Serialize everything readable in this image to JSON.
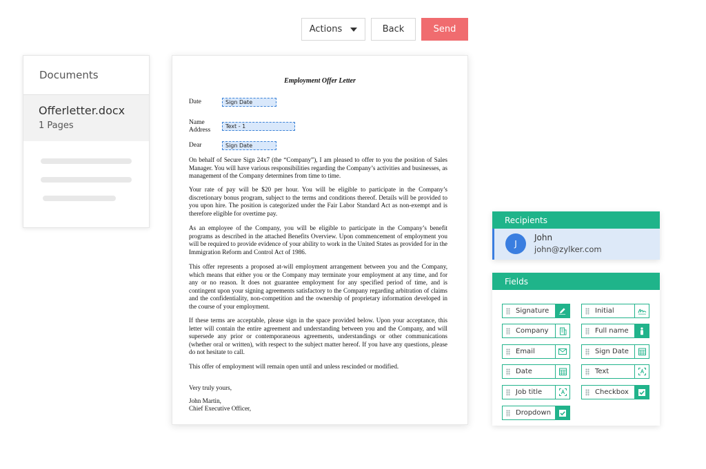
{
  "toolbar": {
    "actions_label": "Actions",
    "back_label": "Back",
    "send_label": "Send"
  },
  "documents": {
    "heading": "Documents",
    "item": {
      "name": "Offerletter.docx",
      "pages": "1 Pages"
    }
  },
  "document": {
    "title": "Employment Offer Letter",
    "labels": {
      "date": "Date",
      "name": "Name",
      "address": "Address",
      "dear": "Dear"
    },
    "fields": {
      "date": "Sign Date",
      "name": "Text - 1",
      "dear": "Sign Date"
    },
    "paragraphs": [
      "On behalf of Secure Sign 24x7 (the “Company”), I am pleased to offer to you the position of Sales Manager. You will have various responsibilities regarding the Company’s activities and businesses, as management of the Company determines from time to time.",
      "Your rate of pay will be $20 per hour. You will be eligible to participate in the Company’s discretionary bonus program, subject to the terms and conditions thereof. Details will be provided to you upon hire. The position is categorized under the Fair Labor Standard Act as non-exempt and is therefore eligible for overtime pay.",
      "As an employee of the Company, you will be eligible to participate in the Company’s benefit programs as described in the attached Benefits Overview. Upon commencement of employment you will be required to provide evidence of your ability to work in the United States as provided for in the Immigration Reform and Control Act of 1986.",
      "This offer represents a proposed at-will employment arrangement between you and the Company, which means that either you or the Company may terminate your employment at any time, and for any or no reason. It does not guarantee employment for any specified period of time, and is contingent upon your signing agreements satisfactory to the Company regarding arbitration of claims and the confidentiality, non-competition and the ownership of proprietary information developed in the course of your employment.",
      "If these terms are acceptable, please sign in the space provided below. Upon your acceptance, this letter will contain the entire agreement and understanding between you and the Company, and will supersede any prior or contemporaneous agreements, understandings or other communications (whether oral or written), with respect to the subject matter hereof. If you have any questions, please do not hesitate to call.",
      "This offer of employment will remain open until and unless rescinded or modified."
    ],
    "closing": "Very truly yours,",
    "signer_name": "John Martin,",
    "signer_title": "Chief Executive Officer,"
  },
  "recipients": {
    "heading": "Recipients",
    "items": [
      {
        "initial": "J",
        "name": "John",
        "email": "john@zylker.com"
      }
    ]
  },
  "fields_panel": {
    "heading": "Fields",
    "items": [
      {
        "label": "Signature",
        "icon": "pen-icon"
      },
      {
        "label": "Initial",
        "icon": "initial-icon"
      },
      {
        "label": "Company",
        "icon": "building-icon"
      },
      {
        "label": "Full name",
        "icon": "person-icon"
      },
      {
        "label": "Email",
        "icon": "envelope-icon"
      },
      {
        "label": "Sign Date",
        "icon": "calendar-icon"
      },
      {
        "label": "Date",
        "icon": "calendar-icon"
      },
      {
        "label": "Text",
        "icon": "text-icon"
      },
      {
        "label": "Job title",
        "icon": "text-icon"
      },
      {
        "label": "Checkbox",
        "icon": "checkbox-icon"
      },
      {
        "label": "Dropdown",
        "icon": "checkbox-icon"
      }
    ]
  },
  "colors": {
    "accent_green": "#1fb48a",
    "send_red": "#f06c6f",
    "recipient_blue": "#3a7ee0",
    "field_highlight": "#d9e8fb"
  }
}
